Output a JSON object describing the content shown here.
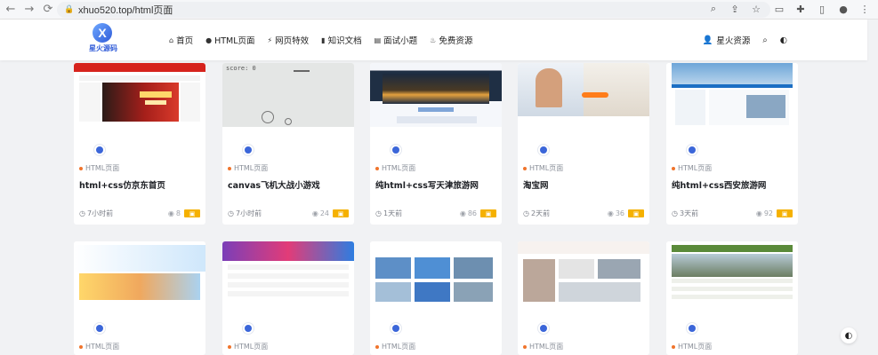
{
  "browser": {
    "url": "xhuo520.top/html页面",
    "back_icon": "arrow-left",
    "forward_icon": "arrow-right",
    "reload_icon": "reload"
  },
  "header": {
    "logo_text": "星火源码",
    "nav": [
      {
        "label": "首页",
        "icon": "home-icon"
      },
      {
        "label": "HTML页面",
        "icon": "apple-icon"
      },
      {
        "label": "网页特效",
        "icon": "bolt-icon"
      },
      {
        "label": "知识文档",
        "icon": "book-icon"
      },
      {
        "label": "面试小题",
        "icon": "file-icon"
      },
      {
        "label": "免费资源",
        "icon": "fire-icon"
      }
    ],
    "user_label": "星火资源"
  },
  "cards_row1": [
    {
      "category": "HTML页面",
      "title": "html+css仿京东首页",
      "time": "7小时前",
      "views": "8"
    },
    {
      "category": "HTML页面",
      "title": "canvas飞机大战小游戏",
      "time": "7小时前",
      "views": "24",
      "score_text": "score: 0"
    },
    {
      "category": "HTML页面",
      "title": "纯html+css写天津旅游网",
      "time": "1天前",
      "views": "86"
    },
    {
      "category": "HTML页面",
      "title": "淘宝网",
      "time": "2天前",
      "views": "36"
    },
    {
      "category": "HTML页面",
      "title": "纯html+css西安旅游网",
      "time": "3天前",
      "views": "92"
    }
  ],
  "cards_row2": [
    {
      "category": "HTML页面"
    },
    {
      "category": "HTML页面"
    },
    {
      "category": "HTML页面"
    },
    {
      "category": "HTML页面"
    },
    {
      "category": "HTML页面"
    }
  ]
}
